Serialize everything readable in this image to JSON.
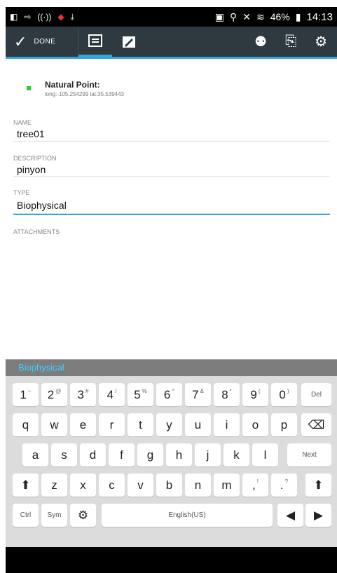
{
  "statusbar": {
    "battery": "46%",
    "time": "14:13"
  },
  "actionbar": {
    "done_label": "DONE"
  },
  "point": {
    "title": "Natural Point:",
    "coords": "long:-105.254299 lat:35.539443"
  },
  "fields": {
    "name": {
      "label": "NAME",
      "value": "tree01"
    },
    "description": {
      "label": "DESCRIPTION",
      "value": "pinyon"
    },
    "type": {
      "label": "TYPE",
      "value": "Biophysical"
    }
  },
  "attachments_label": "ATTACHMENTS",
  "suggestion": "Biophysical",
  "keyboard": {
    "row1": [
      {
        "k": "1",
        "s": "~"
      },
      {
        "k": "2",
        "s": "@"
      },
      {
        "k": "3",
        "s": "#"
      },
      {
        "k": "4",
        "s": "/"
      },
      {
        "k": "5",
        "s": "%"
      },
      {
        "k": "6",
        "s": "^"
      },
      {
        "k": "7",
        "s": "&"
      },
      {
        "k": "8",
        "s": "*"
      },
      {
        "k": "9",
        "s": "("
      },
      {
        "k": "0",
        "s": ")"
      }
    ],
    "del": "Del",
    "row2": [
      "q",
      "w",
      "e",
      "r",
      "t",
      "y",
      "u",
      "i",
      "o",
      "p"
    ],
    "row3": [
      "a",
      "s",
      "d",
      "f",
      "g",
      "h",
      "j",
      "k",
      "l"
    ],
    "next": "Next",
    "row4": [
      "z",
      "x",
      "c",
      "v",
      "b",
      "n",
      "m"
    ],
    "row4_punct": [
      {
        "k": ",",
        "s": "!"
      },
      {
        "k": ".",
        "s": "?"
      }
    ],
    "ctrl": "Ctrl",
    "sym": "Sym",
    "space": "English(US)"
  }
}
